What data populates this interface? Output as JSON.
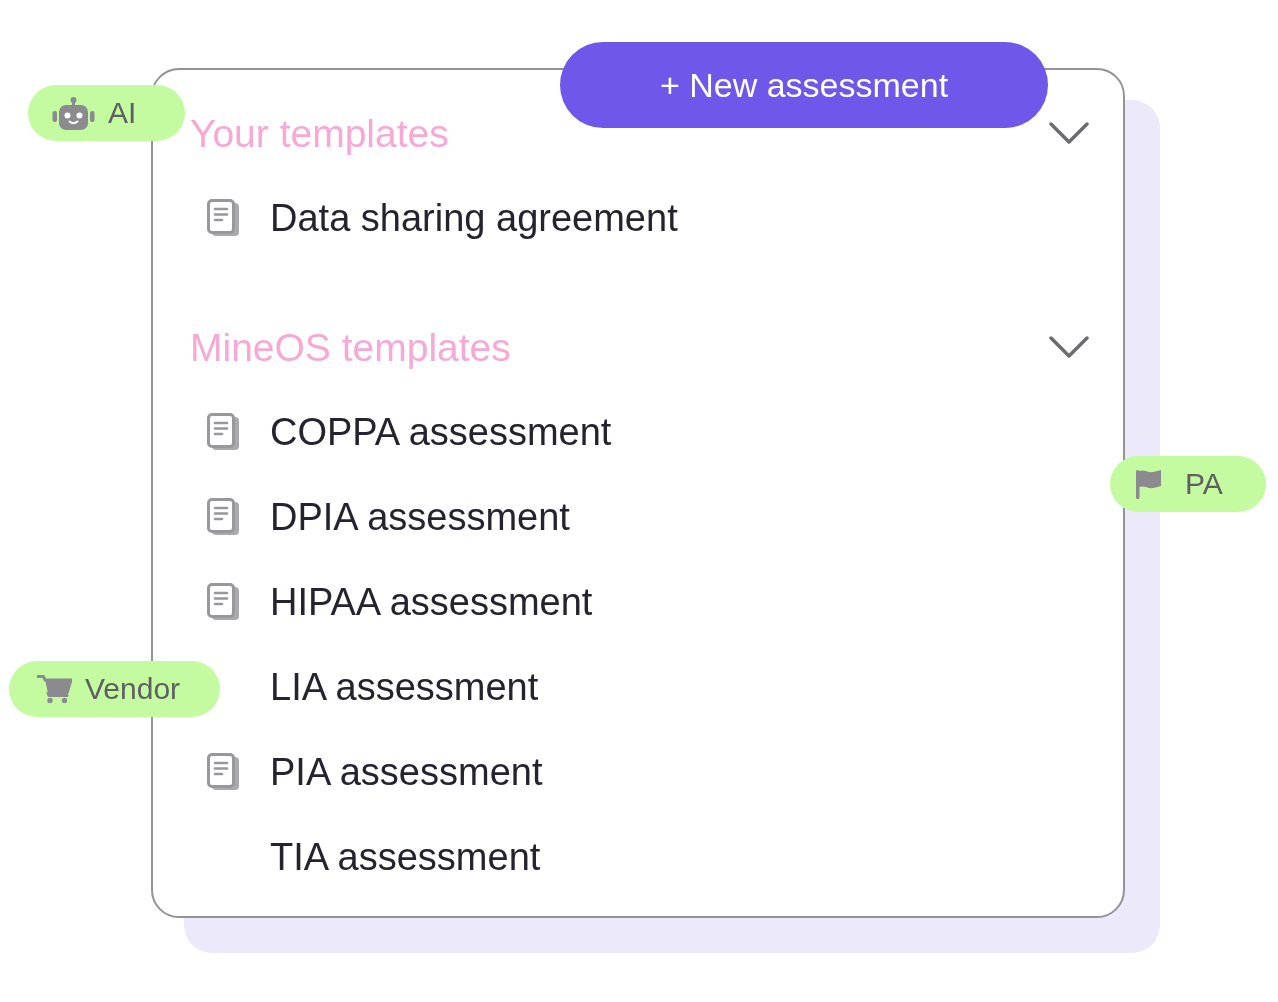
{
  "new_button": {
    "label": "+ New assessment"
  },
  "sections": [
    {
      "title": "Your templates",
      "expanded": true,
      "items": [
        {
          "kind": "document",
          "label": "Data sharing agreement"
        }
      ]
    },
    {
      "title": "MineOS templates",
      "expanded": true,
      "items": [
        {
          "kind": "document",
          "label": "COPPA assessment"
        },
        {
          "kind": "document",
          "label": "DPIA assessment"
        },
        {
          "kind": "document",
          "label": "HIPAA assessment"
        },
        {
          "kind": "plain",
          "label": "LIA assessment"
        },
        {
          "kind": "document",
          "label": "PIA assessment"
        },
        {
          "kind": "plain",
          "label": "TIA assessment"
        }
      ]
    }
  ],
  "tags": [
    {
      "label": "AI"
    },
    {
      "label": "PA"
    },
    {
      "label": "Vendor"
    }
  ]
}
